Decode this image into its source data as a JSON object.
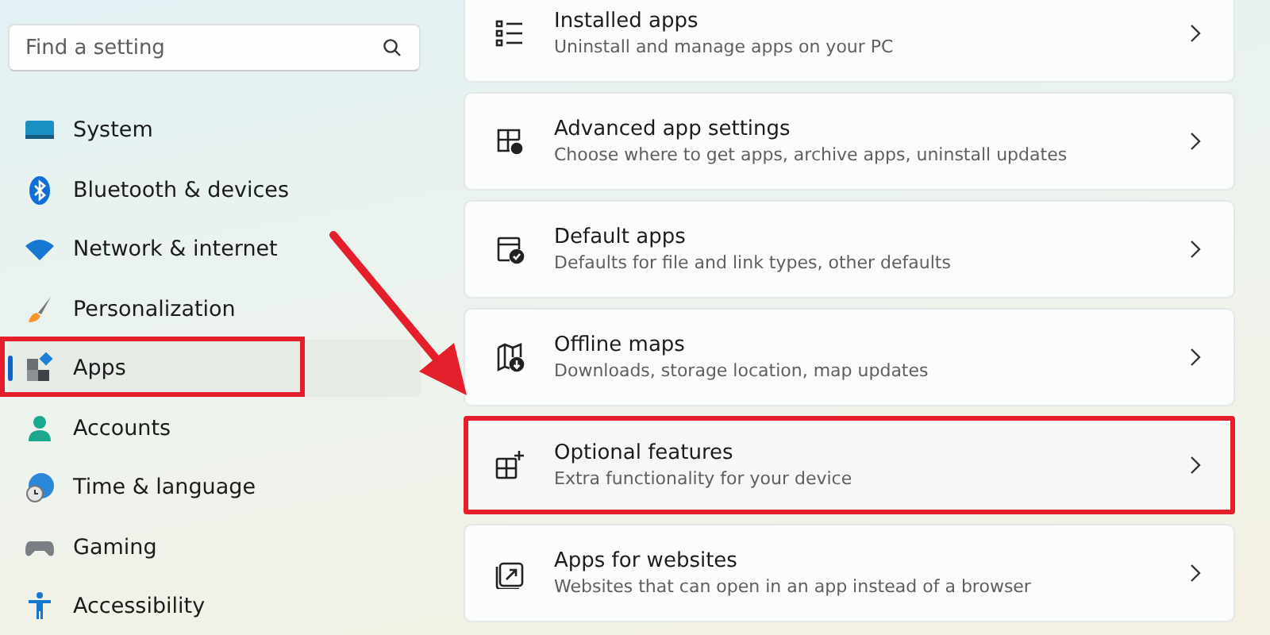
{
  "search": {
    "placeholder": "Find a setting"
  },
  "nav": [
    {
      "label": "System",
      "selected": false,
      "highlighted": false
    },
    {
      "label": "Bluetooth & devices",
      "selected": false,
      "highlighted": false
    },
    {
      "label": "Network & internet",
      "selected": false,
      "highlighted": false
    },
    {
      "label": "Personalization",
      "selected": false,
      "highlighted": false
    },
    {
      "label": "Apps",
      "selected": true,
      "highlighted": true
    },
    {
      "label": "Accounts",
      "selected": false,
      "highlighted": false
    },
    {
      "label": "Time & language",
      "selected": false,
      "highlighted": false
    },
    {
      "label": "Gaming",
      "selected": false,
      "highlighted": false
    },
    {
      "label": "Accessibility",
      "selected": false,
      "highlighted": false
    }
  ],
  "cards": [
    {
      "title": "Installed apps",
      "subtitle": "Uninstall and manage apps on your PC",
      "highlighted": false
    },
    {
      "title": "Advanced app settings",
      "subtitle": "Choose where to get apps, archive apps, uninstall updates",
      "highlighted": false
    },
    {
      "title": "Default apps",
      "subtitle": "Defaults for file and link types, other defaults",
      "highlighted": false
    },
    {
      "title": "Offline maps",
      "subtitle": "Downloads, storage location, map updates",
      "highlighted": false
    },
    {
      "title": "Optional features",
      "subtitle": "Extra functionality for your device",
      "highlighted": true
    },
    {
      "title": "Apps for websites",
      "subtitle": "Websites that can open in an app instead of a browser",
      "highlighted": false
    }
  ],
  "annotation_arrow": true
}
